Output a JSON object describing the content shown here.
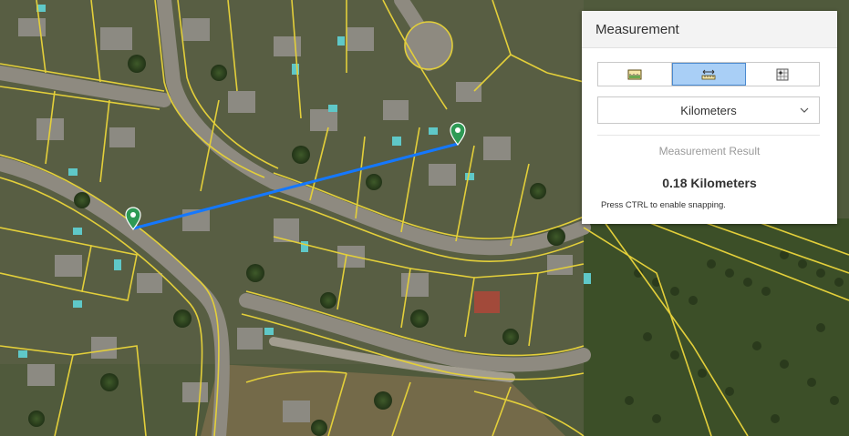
{
  "panel": {
    "title": "Measurement",
    "tools": [
      {
        "name": "area",
        "icon": "area-ruler-icon",
        "active": false
      },
      {
        "name": "distance",
        "icon": "distance-ruler-icon",
        "active": true
      },
      {
        "name": "location",
        "icon": "location-grid-icon",
        "active": false
      }
    ],
    "unit": {
      "selected": "Kilometers"
    },
    "result_label": "Measurement Result",
    "result_value": "0.18 Kilometers",
    "hint": "Press CTRL to enable snapping."
  },
  "map": {
    "measure_line_color": "#1478ff",
    "parcel_color": "#e3cf3a",
    "marker_color": "#2e9a55",
    "markers": [
      "start-marker",
      "end-marker"
    ]
  }
}
